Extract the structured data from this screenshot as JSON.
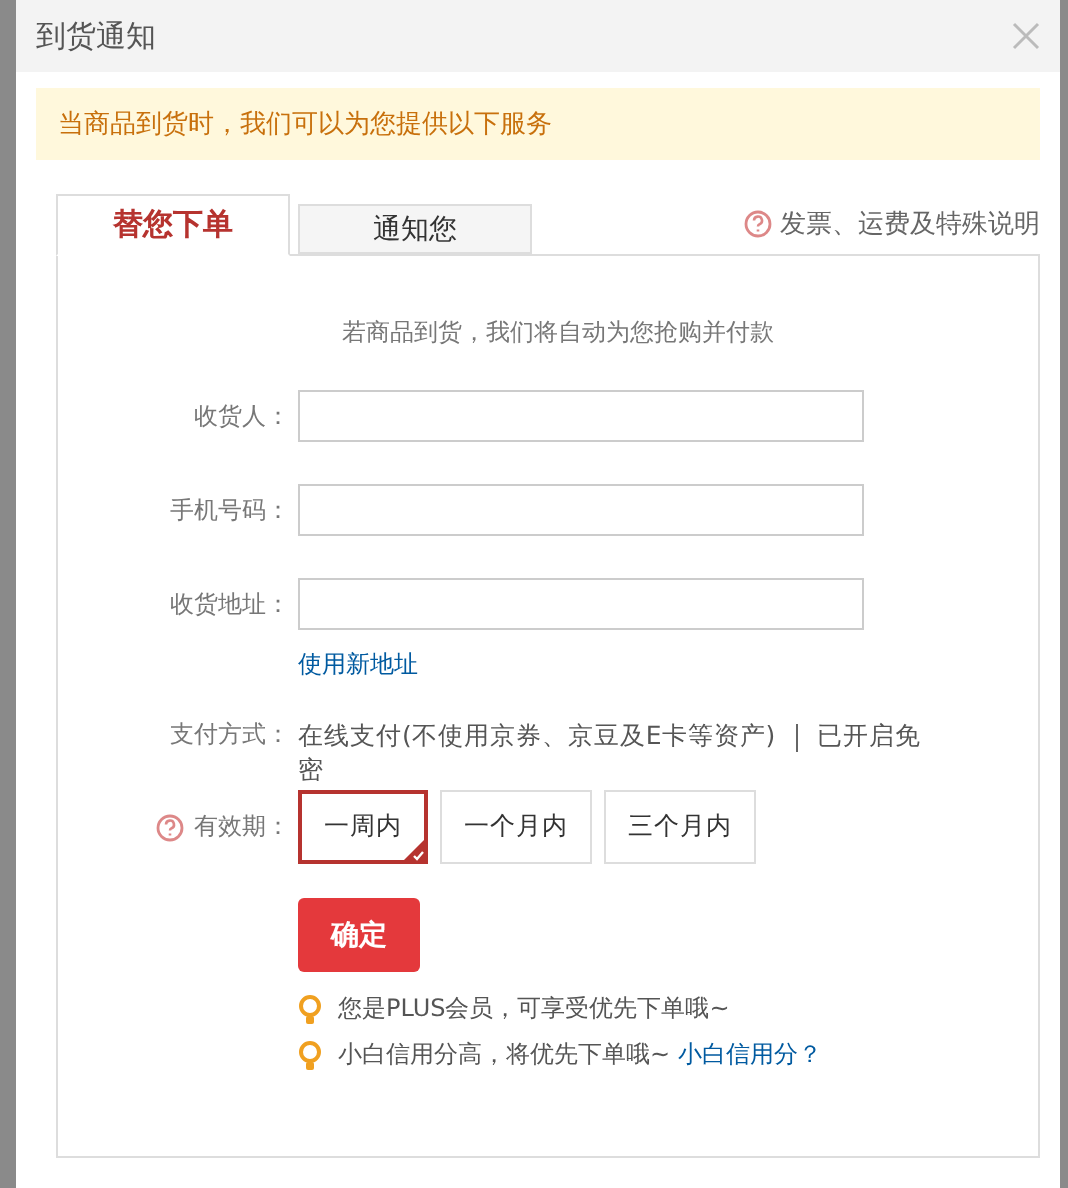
{
  "window": {
    "title": "到货通知"
  },
  "notice": "当商品到货时，我们可以为您提供以下服务",
  "tabs": [
    {
      "label": "替您下单",
      "selected": true
    },
    {
      "label": "通知您",
      "selected": false
    }
  ],
  "help_link": "发票、运费及特殊说明",
  "intro": "若商品到货，我们将自动为您抢购并付款",
  "fields": [
    {
      "label": "收货人："
    },
    {
      "label": "手机号码："
    },
    {
      "label": "收货地址："
    }
  ],
  "new_address_link": "使用新地址",
  "payment": {
    "label": "支付方式：",
    "method": "在线支付(不使用京券、京豆及E卡等资产)",
    "extra": "已开启免密"
  },
  "validity": {
    "label": "有效期：",
    "options": [
      {
        "label": "一周内",
        "selected": true
      },
      {
        "label": "一个月内",
        "selected": false
      },
      {
        "label": "三个月内",
        "selected": false
      }
    ]
  },
  "confirm_button": "确定",
  "tips": [
    {
      "text": "您是PLUS会员，可享受优先下单哦~"
    },
    {
      "text": "小白信用分高，将优先下单哦~",
      "link": "小白信用分？"
    }
  ]
}
